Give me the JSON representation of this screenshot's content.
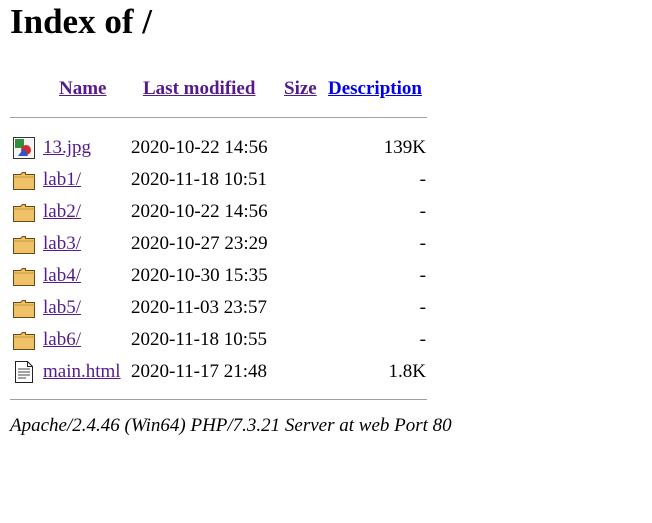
{
  "title": "Index of /",
  "columns": {
    "name": "Name",
    "last_modified": "Last modified",
    "size": "Size",
    "description": "Description"
  },
  "rows": [
    {
      "name": "13.jpg",
      "modified": "2020-10-22 14:56",
      "size": "139K",
      "icon": "image-icon"
    },
    {
      "name": "lab1/",
      "modified": "2020-11-18 10:51",
      "size": "-",
      "icon": "folder-icon"
    },
    {
      "name": "lab2/",
      "modified": "2020-10-22 14:56",
      "size": "-",
      "icon": "folder-icon"
    },
    {
      "name": "lab3/",
      "modified": "2020-10-27 23:29",
      "size": "-",
      "icon": "folder-icon"
    },
    {
      "name": "lab4/",
      "modified": "2020-10-30 15:35",
      "size": "-",
      "icon": "folder-icon"
    },
    {
      "name": "lab5/",
      "modified": "2020-11-03 23:57",
      "size": "-",
      "icon": "folder-icon"
    },
    {
      "name": "lab6/",
      "modified": "2020-11-18 10:55",
      "size": "-",
      "icon": "folder-icon"
    },
    {
      "name": "main.html",
      "modified": "2020-11-17 21:48",
      "size": "1.8K",
      "icon": "text-file-icon"
    }
  ],
  "footer": "Apache/2.4.46 (Win64) PHP/7.3.21 Server at web Port 80",
  "colors": {
    "link": "#551a8b",
    "link_unvisited": "#0000ee",
    "rule": "#a0a0a0"
  }
}
